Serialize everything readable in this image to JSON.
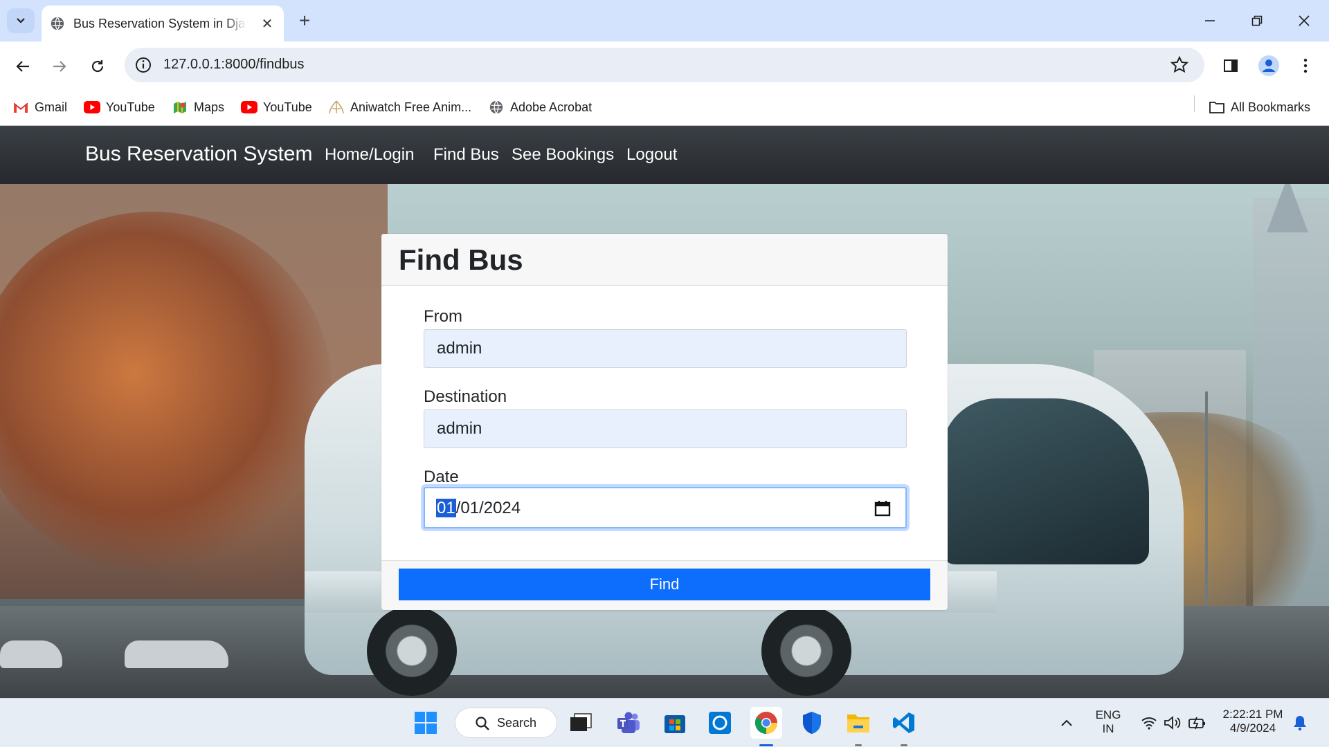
{
  "browser": {
    "tab_title": "Bus Reservation System in Django",
    "url": "127.0.0.1:8000/findbus",
    "new_tab": "+",
    "close_tab": "✕"
  },
  "bookmarks": [
    {
      "label": "Gmail",
      "icon": "gmail-icon"
    },
    {
      "label": "YouTube",
      "icon": "youtube-icon"
    },
    {
      "label": "Maps",
      "icon": "maps-icon"
    },
    {
      "label": "YouTube",
      "icon": "youtube-icon"
    },
    {
      "label": "Aniwatch Free Anim...",
      "icon": "aniwatch-icon"
    },
    {
      "label": "Adobe Acrobat",
      "icon": "globe-icon"
    }
  ],
  "all_bookmarks": "All Bookmarks",
  "site": {
    "brand": "Bus Reservation System",
    "nav": [
      "Home/Login",
      "Find Bus",
      "See Bookings",
      "Logout"
    ]
  },
  "form": {
    "title": "Find Bus",
    "from_label": "From",
    "from_value": "admin",
    "destination_label": "Destination",
    "destination_value": "admin",
    "date_label": "Date",
    "date_day": "01",
    "date_rest": "/01/2024",
    "submit_label": "Find"
  },
  "taskbar": {
    "search_label": "Search",
    "lang_top": "ENG",
    "lang_bottom": "IN",
    "time": "2:22:21 PM",
    "date": "4/9/2024"
  },
  "colors": {
    "primary": "#0d6efd",
    "navbar": "#2b2f33",
    "autofill": "#e8f0fe"
  }
}
